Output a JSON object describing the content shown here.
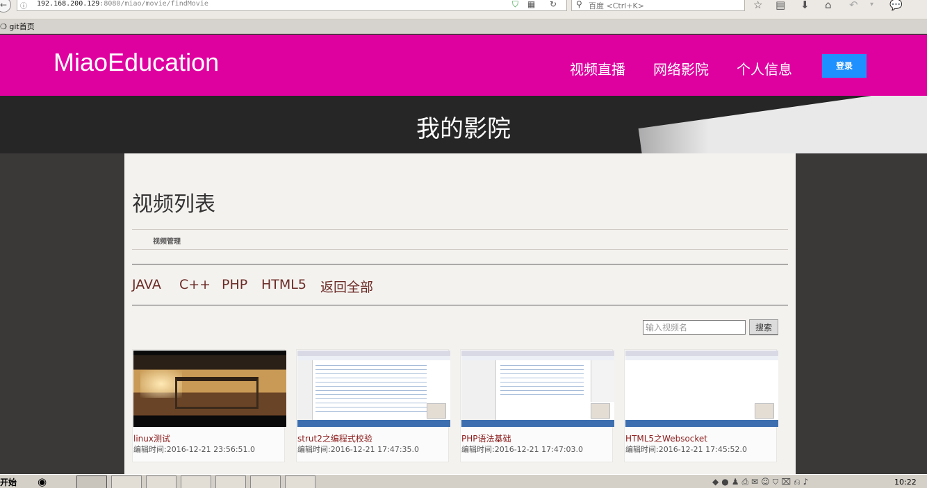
{
  "browser": {
    "url_info": "ⓘ",
    "url_host": "192.168.200.129",
    "url_path": ":8080/miao/movie/findMovie",
    "search_placeholder": "百度 <Ctrl+K>",
    "bookmark": "git首页"
  },
  "site": {
    "brand": "MiaoEducation",
    "nav": [
      "视频直播",
      "网络影院",
      "个人信息"
    ],
    "login_label": "登录",
    "colors": {
      "header": "#df00a0",
      "login": "#1e90ff"
    }
  },
  "hero": {
    "title": "我的影院"
  },
  "main": {
    "list_title": "视频列表",
    "sub_label": "视频管理",
    "categories": [
      "JAVA",
      "C++",
      "PHP",
      "HTML5",
      "返回全部"
    ],
    "search": {
      "placeholder": "输入视频名",
      "button": "搜索"
    },
    "videos": [
      {
        "title": "linux测试",
        "time": "编辑时间:2016-12-21 23:56:51.0"
      },
      {
        "title": "strut2之编程式校验",
        "time": "编辑时间:2016-12-21 17:47:35.0"
      },
      {
        "title": "PHP语法基础",
        "time": "编辑时间:2016-12-21 17:47:03.0"
      },
      {
        "title": "HTML5之Websocket",
        "time": "编辑时间:2016-12-21 17:45:52.0"
      }
    ]
  },
  "taskbar": {
    "start": "开始",
    "clock": "10:22"
  }
}
